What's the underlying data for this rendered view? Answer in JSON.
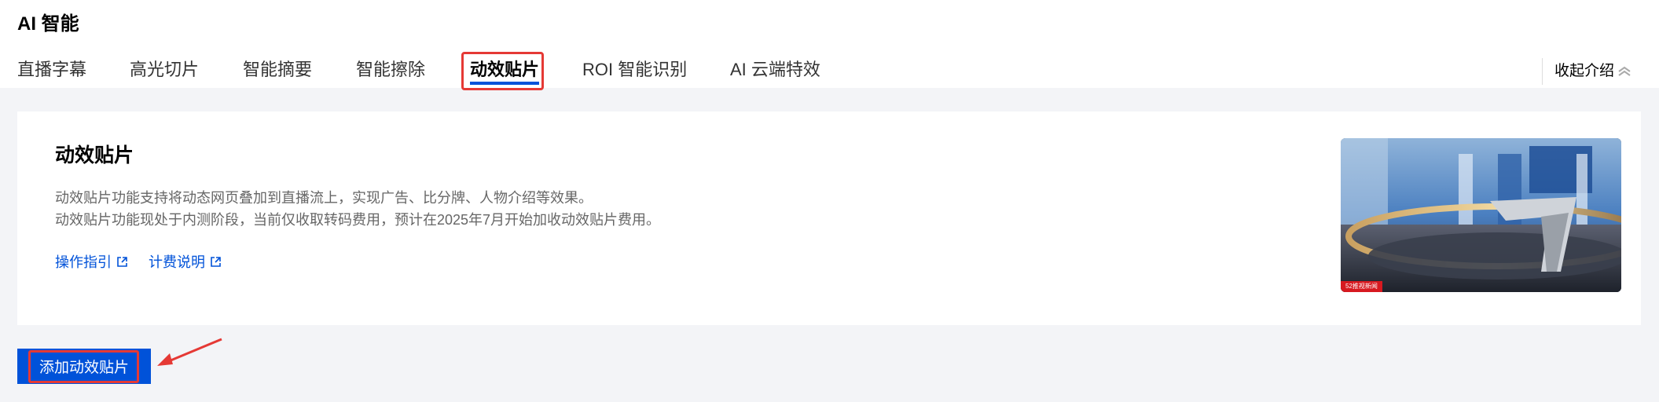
{
  "header": {
    "title": "AI 智能"
  },
  "tabs": [
    {
      "label": "直播字幕"
    },
    {
      "label": "高光切片"
    },
    {
      "label": "智能摘要"
    },
    {
      "label": "智能擦除"
    },
    {
      "label": "动效贴片",
      "active": true
    },
    {
      "label": "ROI 智能识别"
    },
    {
      "label": "AI 云端特效"
    }
  ],
  "collapse_label": "收起介绍",
  "card": {
    "title": "动效贴片",
    "desc_line1": "动效贴片功能支持将动态网页叠加到直播流上，实现广告、比分牌、人物介绍等效果。",
    "desc_line2": "动效贴片功能现处于内测阶段，当前仅收取转码费用，预计在2025年7月开始加收动效贴片费用。",
    "links": [
      {
        "label": "操作指引",
        "icon": "external-link-icon"
      },
      {
        "label": "计费说明",
        "icon": "external-link-icon"
      }
    ],
    "thumbnail_badge": "52推视新闻"
  },
  "add_button": "添加动效贴片",
  "colors": {
    "accent": "#0052d9",
    "highlight": "#e53935"
  }
}
